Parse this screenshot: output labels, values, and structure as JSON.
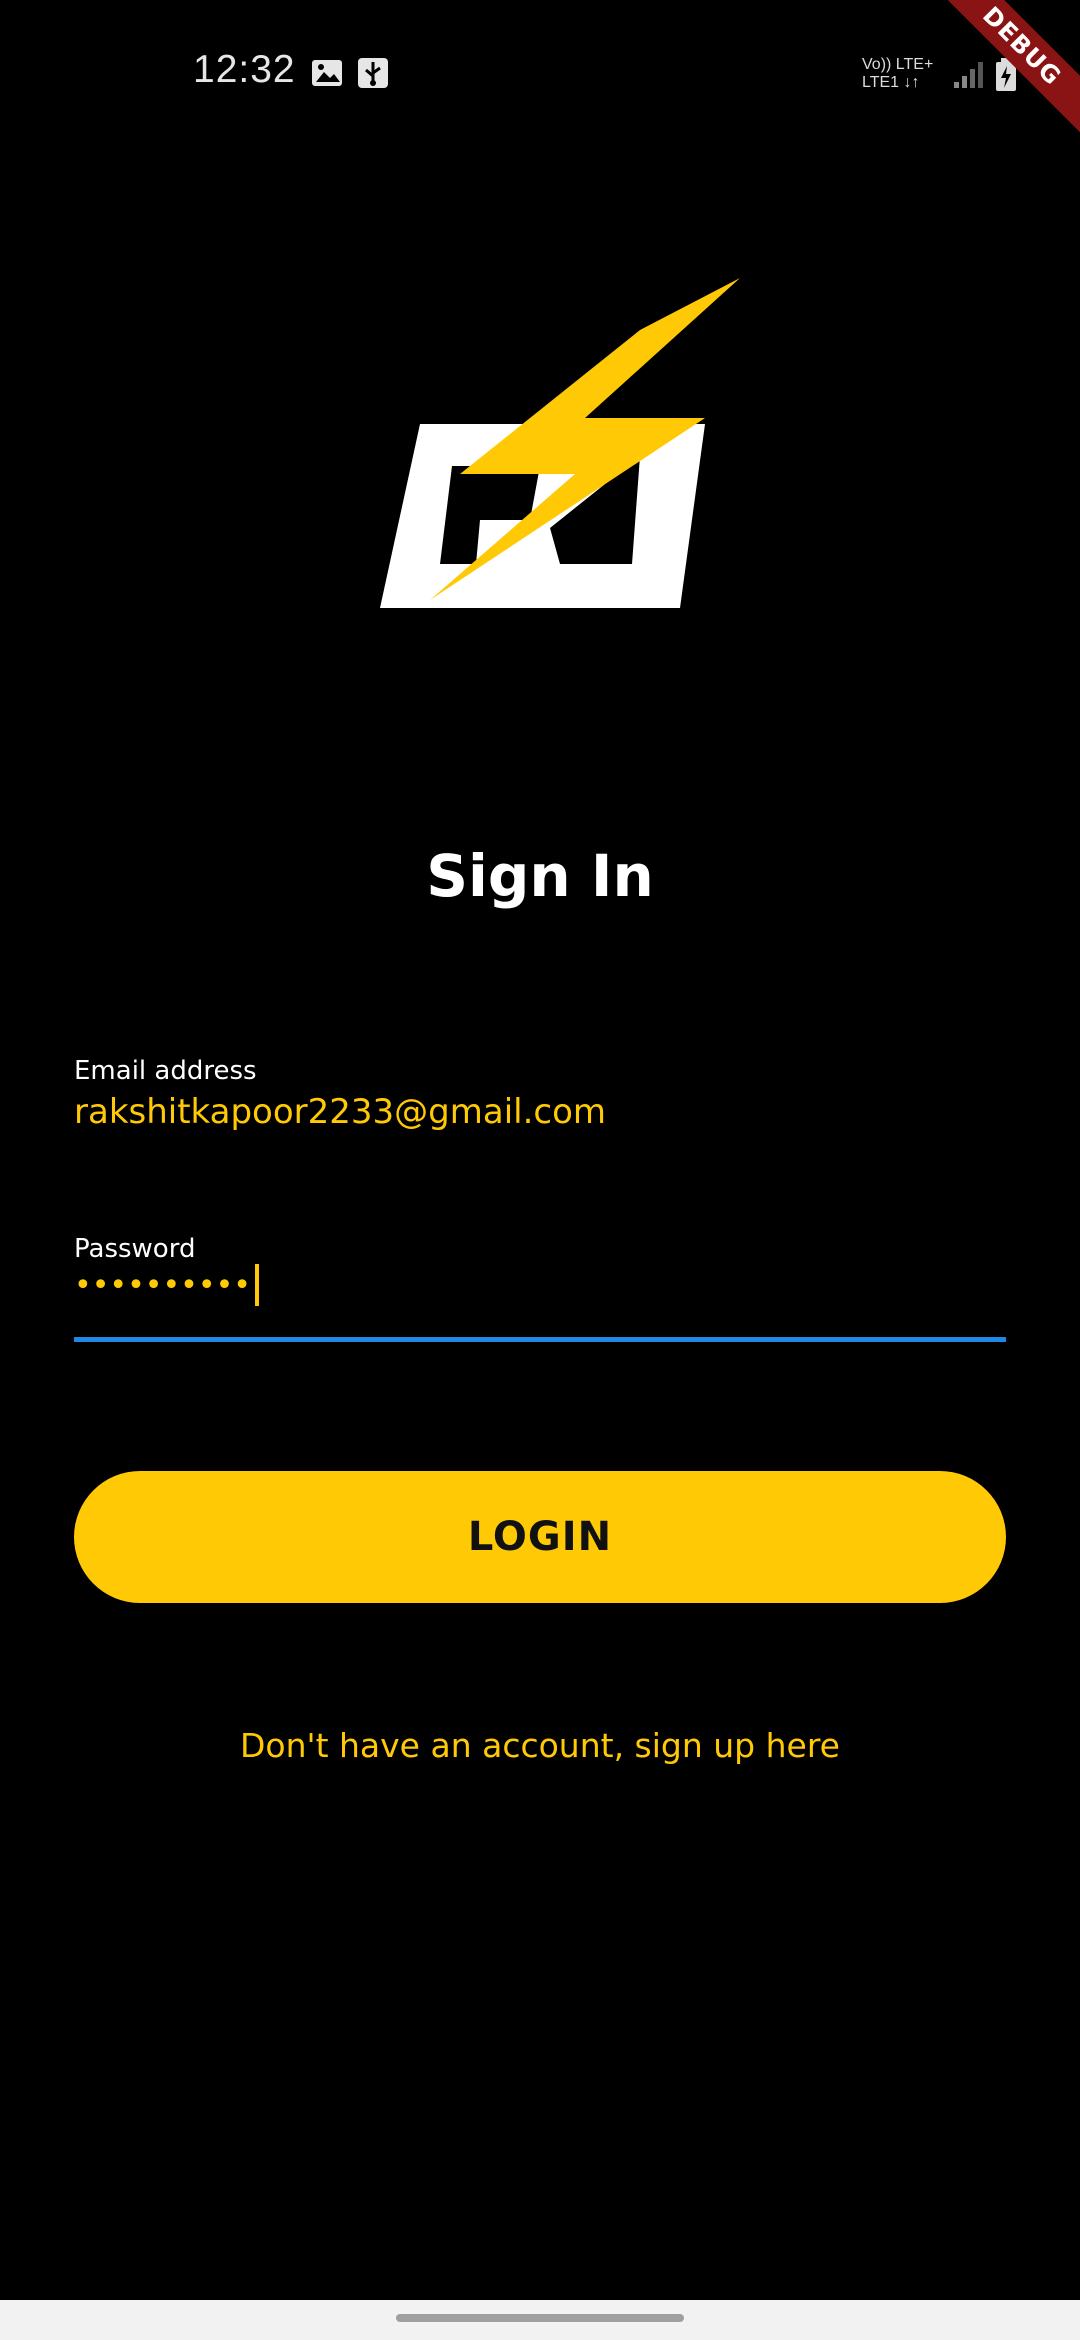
{
  "status_bar": {
    "time": "12:32",
    "network_line1": "Vo)) LTE+",
    "network_line2": "LTE1 ↓↑",
    "debug_label": "DEBUG",
    "icons": [
      "image-icon",
      "usb-icon",
      "signal-icon",
      "battery-icon"
    ]
  },
  "app": {
    "logo_name": "EZ lightning logo",
    "title": "Sign In",
    "accent_color": "#ffca05"
  },
  "form": {
    "email": {
      "label": "Email address",
      "value": "rakshitkapoor2233@gmail.com"
    },
    "password": {
      "label": "Password",
      "value": "••••••••••"
    },
    "login_label": "LOGIN",
    "signup_text": "Don't have an account, sign up here"
  }
}
